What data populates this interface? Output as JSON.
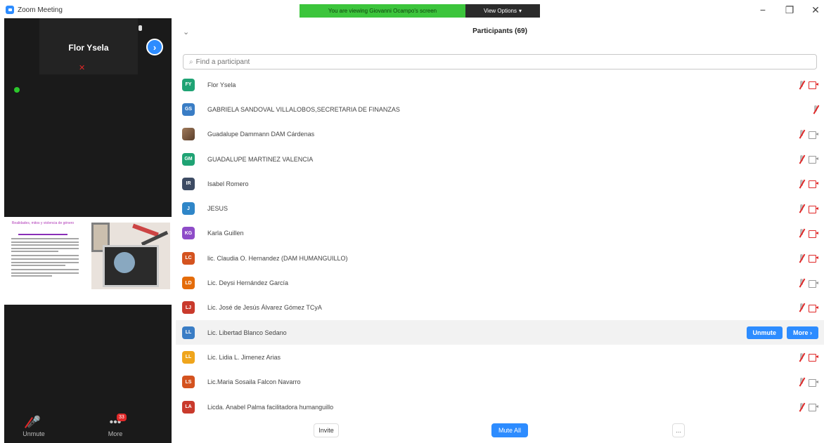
{
  "window": {
    "app_title": "Zoom Meeting",
    "share_banner": "You are viewing Giovanni Ocampo's screen",
    "view_options": "View Options",
    "view_options_caret": "▾",
    "minimize": "−",
    "restore": "❐",
    "close": "✕"
  },
  "video": {
    "speaker_name": "Flor Ysela",
    "next_arrow": "›",
    "slide": {
      "title": "Realidades, mitos y violencia de género"
    },
    "controls": {
      "unmute_label": "Unmute",
      "more_label": "More",
      "more_badge": "33",
      "more_dots": "•••"
    }
  },
  "participants": {
    "collapse_symbol": "⌄",
    "title": "Participants (69)",
    "search_icon": "⌕",
    "search_placeholder": "Find a participant",
    "rows": [
      {
        "initials": "FY",
        "color": "#1fa374",
        "name": "Flor Ysela",
        "cam": "off"
      },
      {
        "initials": "GS",
        "color": "#3a7dc5",
        "name": "GABRIELA SANDOVAL VILLALOBOS,SECRETARIA DE FINANZAS",
        "cam": "none"
      },
      {
        "initials": "",
        "color": "#8b6a4f",
        "name": "Guadalupe Dammann DAM Cárdenas",
        "cam": "on",
        "photo": true
      },
      {
        "initials": "GM",
        "color": "#1fa374",
        "name": "GUADALUPE MARTINEZ VALENCIA",
        "cam": "on"
      },
      {
        "initials": "IR",
        "color": "#3d4b63",
        "name": "Isabel Romero",
        "cam": "off"
      },
      {
        "initials": "J",
        "color": "#2f86c8",
        "name": "JESUS",
        "cam": "off"
      },
      {
        "initials": "KG",
        "color": "#8e4cc8",
        "name": "Karla Guillen",
        "cam": "off"
      },
      {
        "initials": "LC",
        "color": "#d4531f",
        "name": "lic. Claudia O. Hernandez (DAM HUMANGUILLO)",
        "cam": "off"
      },
      {
        "initials": "LD",
        "color": "#e46c0a",
        "name": "Lic. Deysi Hernández García",
        "cam": "on"
      },
      {
        "initials": "LJ",
        "color": "#c93a2c",
        "name": "Lic. José de Jesús Álvarez Gómez TCyA",
        "cam": "off"
      },
      {
        "initials": "LL",
        "color": "#3a7dc5",
        "name": "Lic. Libertad Blanco Sedano",
        "cam": "none",
        "highlight": true
      },
      {
        "initials": "LL",
        "color": "#efa51c",
        "name": "Lic. Lidia L. Jimenez Arias",
        "cam": "off"
      },
      {
        "initials": "LS",
        "color": "#d4531f",
        "name": "Lic.Maria Sosaila Falcon Navarro",
        "cam": "on"
      },
      {
        "initials": "LA",
        "color": "#c93a2c",
        "name": "Licda. Anabel Palma facilitadora humanguillo",
        "cam": "on"
      }
    ],
    "highlight_actions": {
      "unmute": "Unmute",
      "more": "More ›"
    },
    "footer": {
      "invite": "Invite",
      "mute_all": "Mute All",
      "more": "..."
    }
  }
}
